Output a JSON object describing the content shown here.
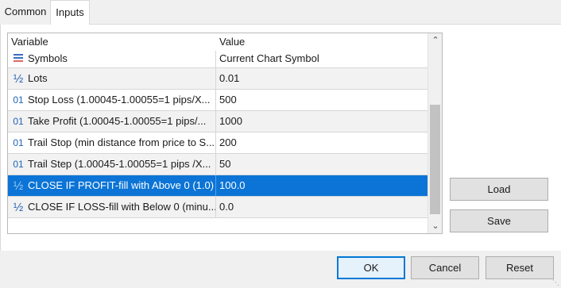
{
  "tabs": [
    {
      "label": "Common",
      "active": false
    },
    {
      "label": "Inputs",
      "active": true
    }
  ],
  "grid": {
    "columns": {
      "variable": "Variable",
      "value": "Value"
    },
    "rows": [
      {
        "icon": "symbols-icon",
        "variable": "Symbols",
        "value": "Current Chart Symbol"
      },
      {
        "icon": "half-fraction-icon",
        "iconGlyph": "½",
        "variable": "Lots",
        "value": "0.01"
      },
      {
        "icon": "integer-01-icon",
        "iconGlyph": "01",
        "variable": "Stop Loss (1.00045-1.00055=1 pips/X...",
        "value": "500"
      },
      {
        "icon": "integer-01-icon",
        "iconGlyph": "01",
        "variable": "Take Profit (1.00045-1.00055=1 pips/...",
        "value": "1000"
      },
      {
        "icon": "integer-01-icon",
        "iconGlyph": "01",
        "variable": "Trail Stop (min distance from price to S...",
        "value": "200"
      },
      {
        "icon": "integer-01-icon",
        "iconGlyph": "01",
        "variable": "Trail Step (1.00045-1.00055=1 pips /X...",
        "value": "50"
      },
      {
        "icon": "half-fraction-icon",
        "iconGlyph": "½",
        "variable": "CLOSE IF PROFIT-fill with Above 0 (1.0)",
        "value": "100.0",
        "selected": true
      },
      {
        "icon": "half-fraction-icon",
        "iconGlyph": "½",
        "variable": "CLOSE IF LOSS-fill with Below 0 (minu...",
        "value": "0.0"
      }
    ]
  },
  "buttons": {
    "load": "Load",
    "save": "Save",
    "ok": "OK",
    "cancel": "Cancel",
    "reset": "Reset"
  },
  "colors": {
    "selection": "#0b74d6",
    "okBorder": "#0078d7"
  }
}
